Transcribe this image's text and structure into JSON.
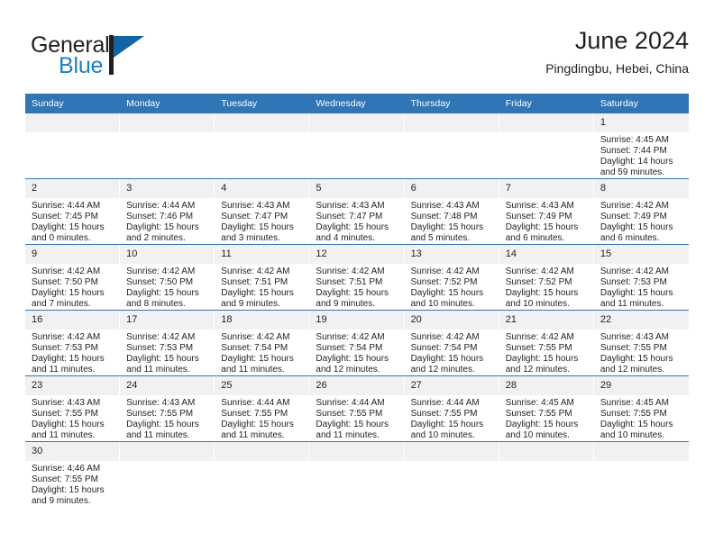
{
  "brand": {
    "line1": "General",
    "line2": "Blue",
    "mark": "triangle-flag-icon"
  },
  "header": {
    "title": "June 2024",
    "subtitle": "Pingdingbu, Hebei, China"
  },
  "calendar": {
    "weekday_headers": [
      "Sunday",
      "Monday",
      "Tuesday",
      "Wednesday",
      "Thursday",
      "Friday",
      "Saturday"
    ],
    "accent_color": "#3075b5",
    "daynum_band_color": "#f1f1f1",
    "weeks": [
      [
        {
          "day": "",
          "lines": []
        },
        {
          "day": "",
          "lines": []
        },
        {
          "day": "",
          "lines": []
        },
        {
          "day": "",
          "lines": []
        },
        {
          "day": "",
          "lines": []
        },
        {
          "day": "",
          "lines": []
        },
        {
          "day": "1",
          "lines": [
            "Sunrise: 4:45 AM",
            "Sunset: 7:44 PM",
            "Daylight: 14 hours",
            "and 59 minutes."
          ]
        }
      ],
      [
        {
          "day": "2",
          "lines": [
            "Sunrise: 4:44 AM",
            "Sunset: 7:45 PM",
            "Daylight: 15 hours",
            "and 0 minutes."
          ]
        },
        {
          "day": "3",
          "lines": [
            "Sunrise: 4:44 AM",
            "Sunset: 7:46 PM",
            "Daylight: 15 hours",
            "and 2 minutes."
          ]
        },
        {
          "day": "4",
          "lines": [
            "Sunrise: 4:43 AM",
            "Sunset: 7:47 PM",
            "Daylight: 15 hours",
            "and 3 minutes."
          ]
        },
        {
          "day": "5",
          "lines": [
            "Sunrise: 4:43 AM",
            "Sunset: 7:47 PM",
            "Daylight: 15 hours",
            "and 4 minutes."
          ]
        },
        {
          "day": "6",
          "lines": [
            "Sunrise: 4:43 AM",
            "Sunset: 7:48 PM",
            "Daylight: 15 hours",
            "and 5 minutes."
          ]
        },
        {
          "day": "7",
          "lines": [
            "Sunrise: 4:43 AM",
            "Sunset: 7:49 PM",
            "Daylight: 15 hours",
            "and 6 minutes."
          ]
        },
        {
          "day": "8",
          "lines": [
            "Sunrise: 4:42 AM",
            "Sunset: 7:49 PM",
            "Daylight: 15 hours",
            "and 6 minutes."
          ]
        }
      ],
      [
        {
          "day": "9",
          "lines": [
            "Sunrise: 4:42 AM",
            "Sunset: 7:50 PM",
            "Daylight: 15 hours",
            "and 7 minutes."
          ]
        },
        {
          "day": "10",
          "lines": [
            "Sunrise: 4:42 AM",
            "Sunset: 7:50 PM",
            "Daylight: 15 hours",
            "and 8 minutes."
          ]
        },
        {
          "day": "11",
          "lines": [
            "Sunrise: 4:42 AM",
            "Sunset: 7:51 PM",
            "Daylight: 15 hours",
            "and 9 minutes."
          ]
        },
        {
          "day": "12",
          "lines": [
            "Sunrise: 4:42 AM",
            "Sunset: 7:51 PM",
            "Daylight: 15 hours",
            "and 9 minutes."
          ]
        },
        {
          "day": "13",
          "lines": [
            "Sunrise: 4:42 AM",
            "Sunset: 7:52 PM",
            "Daylight: 15 hours",
            "and 10 minutes."
          ]
        },
        {
          "day": "14",
          "lines": [
            "Sunrise: 4:42 AM",
            "Sunset: 7:52 PM",
            "Daylight: 15 hours",
            "and 10 minutes."
          ]
        },
        {
          "day": "15",
          "lines": [
            "Sunrise: 4:42 AM",
            "Sunset: 7:53 PM",
            "Daylight: 15 hours",
            "and 11 minutes."
          ]
        }
      ],
      [
        {
          "day": "16",
          "lines": [
            "Sunrise: 4:42 AM",
            "Sunset: 7:53 PM",
            "Daylight: 15 hours",
            "and 11 minutes."
          ]
        },
        {
          "day": "17",
          "lines": [
            "Sunrise: 4:42 AM",
            "Sunset: 7:53 PM",
            "Daylight: 15 hours",
            "and 11 minutes."
          ]
        },
        {
          "day": "18",
          "lines": [
            "Sunrise: 4:42 AM",
            "Sunset: 7:54 PM",
            "Daylight: 15 hours",
            "and 11 minutes."
          ]
        },
        {
          "day": "19",
          "lines": [
            "Sunrise: 4:42 AM",
            "Sunset: 7:54 PM",
            "Daylight: 15 hours",
            "and 12 minutes."
          ]
        },
        {
          "day": "20",
          "lines": [
            "Sunrise: 4:42 AM",
            "Sunset: 7:54 PM",
            "Daylight: 15 hours",
            "and 12 minutes."
          ]
        },
        {
          "day": "21",
          "lines": [
            "Sunrise: 4:42 AM",
            "Sunset: 7:55 PM",
            "Daylight: 15 hours",
            "and 12 minutes."
          ]
        },
        {
          "day": "22",
          "lines": [
            "Sunrise: 4:43 AM",
            "Sunset: 7:55 PM",
            "Daylight: 15 hours",
            "and 12 minutes."
          ]
        }
      ],
      [
        {
          "day": "23",
          "lines": [
            "Sunrise: 4:43 AM",
            "Sunset: 7:55 PM",
            "Daylight: 15 hours",
            "and 11 minutes."
          ]
        },
        {
          "day": "24",
          "lines": [
            "Sunrise: 4:43 AM",
            "Sunset: 7:55 PM",
            "Daylight: 15 hours",
            "and 11 minutes."
          ]
        },
        {
          "day": "25",
          "lines": [
            "Sunrise: 4:44 AM",
            "Sunset: 7:55 PM",
            "Daylight: 15 hours",
            "and 11 minutes."
          ]
        },
        {
          "day": "26",
          "lines": [
            "Sunrise: 4:44 AM",
            "Sunset: 7:55 PM",
            "Daylight: 15 hours",
            "and 11 minutes."
          ]
        },
        {
          "day": "27",
          "lines": [
            "Sunrise: 4:44 AM",
            "Sunset: 7:55 PM",
            "Daylight: 15 hours",
            "and 10 minutes."
          ]
        },
        {
          "day": "28",
          "lines": [
            "Sunrise: 4:45 AM",
            "Sunset: 7:55 PM",
            "Daylight: 15 hours",
            "and 10 minutes."
          ]
        },
        {
          "day": "29",
          "lines": [
            "Sunrise: 4:45 AM",
            "Sunset: 7:55 PM",
            "Daylight: 15 hours",
            "and 10 minutes."
          ]
        }
      ],
      [
        {
          "day": "30",
          "lines": [
            "Sunrise: 4:46 AM",
            "Sunset: 7:55 PM",
            "Daylight: 15 hours",
            "and 9 minutes."
          ]
        },
        {
          "day": "",
          "lines": []
        },
        {
          "day": "",
          "lines": []
        },
        {
          "day": "",
          "lines": []
        },
        {
          "day": "",
          "lines": []
        },
        {
          "day": "",
          "lines": []
        },
        {
          "day": "",
          "lines": []
        }
      ]
    ]
  }
}
